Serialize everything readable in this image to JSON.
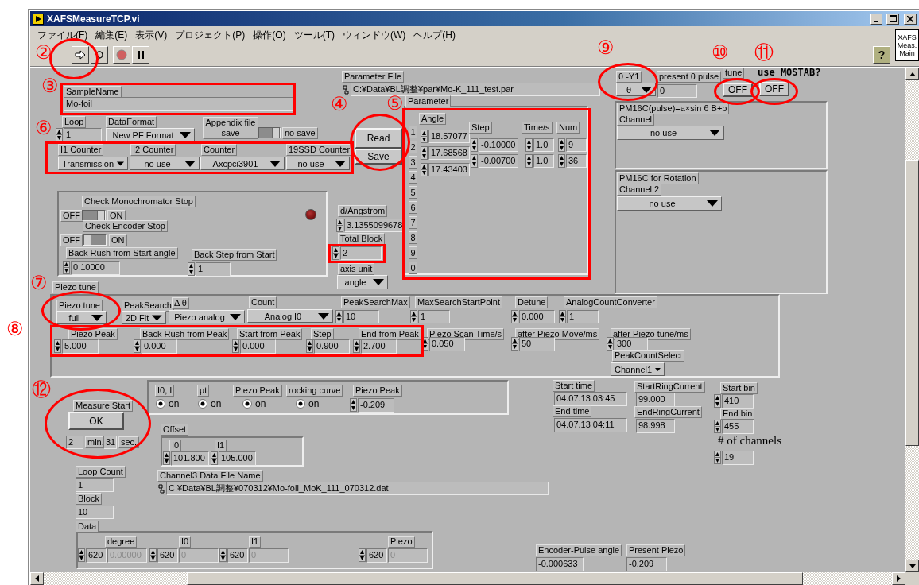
{
  "window": {
    "title": "XAFSMeasureTCP.vi"
  },
  "menu": [
    "ファイル(F)",
    "編集(E)",
    "表示(V)",
    "プロジェクト(P)",
    "操作(O)",
    "ツール(T)",
    "ウィンドウ(W)",
    "ヘルプ(H)"
  ],
  "toolbar": [
    {
      "kind": "run"
    },
    {
      "kind": "run-continuous"
    },
    {
      "kind": "abort"
    },
    {
      "kind": "pause"
    },
    {
      "kind": "help",
      "text": "?"
    }
  ],
  "icon_pane": [
    "XAFS",
    "Meas.",
    "Main"
  ],
  "panel": {
    "items": [
      {
        "kind": "cluster"
      },
      {
        "kind": "cluster"
      },
      {
        "kind": "cluster"
      },
      {
        "kind": "cluster"
      },
      {
        "kind": "cluster"
      },
      {
        "kind": "cluster"
      },
      {
        "kind": "cluster"
      },
      {
        "kind": "cluster"
      },
      {
        "kind": "label",
        "text": "SampleName"
      },
      {
        "kind": "string",
        "value": "Mo-foil"
      },
      {
        "kind": "label",
        "text": "Parameter File"
      },
      {
        "kind": "path",
        "value": "C:¥Data¥BL調整¥par¥Mo-K_111_test.par"
      },
      {
        "kind": "label",
        "text": "Loop"
      },
      {
        "kind": "numeric",
        "value": "1"
      },
      {
        "kind": "label",
        "text": "DataFormat"
      },
      {
        "kind": "ring",
        "value": "New PF Format"
      },
      {
        "kind": "label",
        "text": "Appendix file save"
      },
      {
        "kind": "toggle",
        "on": true
      },
      {
        "kind": "label",
        "text": "no save"
      },
      {
        "kind": "label",
        "text": "I1 Counter"
      },
      {
        "kind": "ring",
        "value": "Transmission"
      },
      {
        "kind": "label",
        "text": "I2 Counter"
      },
      {
        "kind": "ring",
        "value": "no use"
      },
      {
        "kind": "label",
        "text": "Counter"
      },
      {
        "kind": "ring",
        "value": "Axcpci3901"
      },
      {
        "kind": "label",
        "text": "19SSD Counter"
      },
      {
        "kind": "ring",
        "value": "no use"
      },
      {
        "kind": "button",
        "text": "Read"
      },
      {
        "kind": "button",
        "text": "Save"
      },
      {
        "kind": "label",
        "text": "Parameter"
      },
      {
        "kind": "label",
        "text": "Angle"
      },
      {
        "kind": "array-index",
        "values": [
          "1",
          "2",
          "3",
          "4",
          "5",
          "6",
          "7",
          "8",
          "9",
          "0"
        ]
      },
      {
        "kind": "numeric",
        "value": "18.57077"
      },
      {
        "kind": "numeric",
        "value": "17.68568"
      },
      {
        "kind": "numeric",
        "value": "17.43403"
      },
      {
        "kind": "label",
        "text": "Step"
      },
      {
        "kind": "numeric",
        "value": "-0.10000"
      },
      {
        "kind": "numeric",
        "value": "-0.00700"
      },
      {
        "kind": "label",
        "text": "Time/s"
      },
      {
        "kind": "numeric",
        "value": "1.0"
      },
      {
        "kind": "numeric",
        "value": "1.0"
      },
      {
        "kind": "label",
        "text": "Num"
      },
      {
        "kind": "numeric",
        "value": "9"
      },
      {
        "kind": "numeric",
        "value": "36"
      },
      {
        "kind": "label",
        "text": "θ -Y1"
      },
      {
        "kind": "ring",
        "value": "θ"
      },
      {
        "kind": "label",
        "text": "present θ pulse"
      },
      {
        "kind": "indicator",
        "value": "0",
        "disabled": false
      },
      {
        "kind": "label",
        "text": "tune"
      },
      {
        "kind": "button",
        "text": "OFF"
      },
      {
        "kind": "heading",
        "text": "use MOSTAB?"
      },
      {
        "kind": "button",
        "text": "OFF"
      },
      {
        "kind": "label",
        "text": "PM16C(pulse)=a×sin θ B+b"
      },
      {
        "kind": "label",
        "text": "Channel"
      },
      {
        "kind": "ring",
        "value": "no use"
      },
      {
        "kind": "label",
        "text": "PM16C for Rotation"
      },
      {
        "kind": "label",
        "text": "Channel 2"
      },
      {
        "kind": "ring",
        "value": "no use"
      },
      {
        "kind": "label",
        "text": "Check Monochromator Stop"
      },
      {
        "kind": "label",
        "text": "OFF"
      },
      {
        "kind": "toggle",
        "on": true
      },
      {
        "kind": "label",
        "text": "ON"
      },
      {
        "kind": "label",
        "text": "Check Encoder Stop"
      },
      {
        "kind": "label",
        "text": "OFF"
      },
      {
        "kind": "toggle",
        "on": false
      },
      {
        "kind": "label",
        "text": "ON"
      },
      {
        "kind": "label",
        "text": "Back Rush from Start angle"
      },
      {
        "kind": "numeric",
        "value": "0.10000"
      },
      {
        "kind": "label",
        "text": "Back Step from Start"
      },
      {
        "kind": "numeric",
        "value": "1"
      },
      {
        "kind": "led",
        "on": false
      },
      {
        "kind": "label",
        "text": "d/Angstrom"
      },
      {
        "kind": "numeric",
        "value": "3.1355099678"
      },
      {
        "kind": "label",
        "text": "Total Block"
      },
      {
        "kind": "numeric",
        "value": "2"
      },
      {
        "kind": "label",
        "text": "axis unit"
      },
      {
        "kind": "ring",
        "value": "angle"
      },
      {
        "kind": "label",
        "text": "Piezo tune"
      },
      {
        "kind": "label",
        "text": "Piezo tune"
      },
      {
        "kind": "ring",
        "value": "full"
      },
      {
        "kind": "label",
        "text": "PeakSearch"
      },
      {
        "kind": "ring",
        "value": "2D Fit"
      },
      {
        "kind": "label",
        "text": "Δ θ"
      },
      {
        "kind": "ring",
        "value": "Piezo analog"
      },
      {
        "kind": "label",
        "text": "Count"
      },
      {
        "kind": "ring",
        "value": "Analog I0"
      },
      {
        "kind": "label",
        "text": "PeakSearchMax"
      },
      {
        "kind": "numeric",
        "value": "10"
      },
      {
        "kind": "label",
        "text": "MaxSearchStartPoint"
      },
      {
        "kind": "numeric",
        "value": "1"
      },
      {
        "kind": "label",
        "text": "Detune"
      },
      {
        "kind": "numeric",
        "value": "0.000"
      },
      {
        "kind": "label",
        "text": "AnalogCountConverter"
      },
      {
        "kind": "numeric",
        "value": "1"
      },
      {
        "kind": "label",
        "text": "Piezo Peak"
      },
      {
        "kind": "numeric",
        "value": "5.000"
      },
      {
        "kind": "label",
        "text": "Back Rush from Peak"
      },
      {
        "kind": "numeric",
        "value": "0.000"
      },
      {
        "kind": "label",
        "text": "Start from Peak"
      },
      {
        "kind": "numeric",
        "value": "0.000"
      },
      {
        "kind": "label",
        "text": "Step"
      },
      {
        "kind": "numeric",
        "value": "0.900"
      },
      {
        "kind": "label",
        "text": "End from Peak"
      },
      {
        "kind": "numeric",
        "value": "2.700"
      },
      {
        "kind": "label",
        "text": "Piezo Scan Time/s"
      },
      {
        "kind": "numeric",
        "value": "0.050"
      },
      {
        "kind": "label",
        "text": "after Piezo Move/ms"
      },
      {
        "kind": "numeric",
        "value": "50"
      },
      {
        "kind": "label",
        "text": "after Piezo tune/ms"
      },
      {
        "kind": "numeric",
        "value": "300"
      },
      {
        "kind": "label",
        "text": "PeakCountSelect"
      },
      {
        "kind": "ring",
        "value": "Channel1"
      },
      {
        "kind": "label",
        "text": "Measure Start"
      },
      {
        "kind": "button",
        "text": "OK"
      },
      {
        "kind": "indicator",
        "value": "2",
        "disabled": false
      },
      {
        "kind": "label",
        "text": "min."
      },
      {
        "kind": "indicator",
        "value": "31",
        "disabled": false
      },
      {
        "kind": "label",
        "text": "sec."
      },
      {
        "kind": "label",
        "text": "I0, I"
      },
      {
        "kind": "radio",
        "text": "on",
        "selected": true
      },
      {
        "kind": "label",
        "text": "μt"
      },
      {
        "kind": "radio",
        "text": "on",
        "selected": true
      },
      {
        "kind": "label",
        "text": "Piezo Peak"
      },
      {
        "kind": "radio",
        "text": "on",
        "selected": true
      },
      {
        "kind": "label",
        "text": "rocking curve"
      },
      {
        "kind": "radio",
        "text": "on",
        "selected": true
      },
      {
        "kind": "label",
        "text": "Piezo Peak"
      },
      {
        "kind": "numeric",
        "value": "-0.209"
      },
      {
        "kind": "label",
        "text": "Offset"
      },
      {
        "kind": "label",
        "text": "I0"
      },
      {
        "kind": "label",
        "text": "I1"
      },
      {
        "kind": "numeric",
        "value": "101.800"
      },
      {
        "kind": "numeric",
        "value": "105.000"
      },
      {
        "kind": "label",
        "text": "Loop Count"
      },
      {
        "kind": "indicator",
        "value": "1",
        "disabled": false
      },
      {
        "kind": "label",
        "text": "Channel3 Data File Name"
      },
      {
        "kind": "path",
        "value": "C:¥Data¥BL調整¥070312¥Mo-foil_MoK_111_070312.dat"
      },
      {
        "kind": "label",
        "text": "Block"
      },
      {
        "kind": "indicator",
        "value": "10",
        "disabled": false
      },
      {
        "kind": "label",
        "text": "Data"
      },
      {
        "kind": "label",
        "text": "degree"
      },
      {
        "kind": "numeric",
        "value": "620"
      },
      {
        "kind": "indicator",
        "value": "0.00000",
        "disabled": true
      },
      {
        "kind": "label",
        "text": "I0"
      },
      {
        "kind": "numeric",
        "value": "620"
      },
      {
        "kind": "indicator",
        "value": "0",
        "disabled": true
      },
      {
        "kind": "label",
        "text": "I1"
      },
      {
        "kind": "numeric",
        "value": "620"
      },
      {
        "kind": "indicator",
        "value": "0",
        "disabled": true
      },
      {
        "kind": "label",
        "text": "Piezo"
      },
      {
        "kind": "numeric",
        "value": "620"
      },
      {
        "kind": "indicator",
        "value": "0",
        "disabled": true
      },
      {
        "kind": "label",
        "text": "Start time"
      },
      {
        "kind": "indicator",
        "value": "04.07.13 03:45",
        "disabled": false
      },
      {
        "kind": "label",
        "text": "End time"
      },
      {
        "kind": "indicator",
        "value": "04.07.13 04:11",
        "disabled": false
      },
      {
        "kind": "label",
        "text": "StartRingCurrent"
      },
      {
        "kind": "indicator",
        "value": "99.000",
        "disabled": false
      },
      {
        "kind": "label",
        "text": "EndRingCurrent"
      },
      {
        "kind": "indicator",
        "value": "98.998",
        "disabled": false
      },
      {
        "kind": "label",
        "text": "Start bin"
      },
      {
        "kind": "numeric",
        "value": "410"
      },
      {
        "kind": "label",
        "text": "End bin"
      },
      {
        "kind": "numeric",
        "value": "455"
      },
      {
        "kind": "caption",
        "text": "# of channels"
      },
      {
        "kind": "numeric",
        "value": "19"
      },
      {
        "kind": "label",
        "text": "Encoder-Pulse angle"
      },
      {
        "kind": "indicator",
        "value": "-0.000633",
        "disabled": false
      },
      {
        "kind": "label",
        "text": "Present Piezo"
      },
      {
        "kind": "indicator",
        "value": "-0.209",
        "disabled": false
      }
    ]
  },
  "annotations": [
    {
      "kind": "number",
      "text": "②"
    },
    {
      "kind": "ellipse"
    },
    {
      "kind": "number",
      "text": "③"
    },
    {
      "kind": "rect"
    },
    {
      "kind": "number",
      "text": "④"
    },
    {
      "kind": "number",
      "text": "⑤"
    },
    {
      "kind": "ellipse"
    },
    {
      "kind": "number",
      "text": "⑥"
    },
    {
      "kind": "rect"
    },
    {
      "kind": "rect"
    },
    {
      "kind": "number",
      "text": "⑦"
    },
    {
      "kind": "number",
      "text": "⑧"
    },
    {
      "kind": "ellipse"
    },
    {
      "kind": "rect"
    },
    {
      "kind": "number",
      "text": "⑨"
    },
    {
      "kind": "ellipse"
    },
    {
      "kind": "number",
      "text": "⑩"
    },
    {
      "kind": "ellipse"
    },
    {
      "kind": "number",
      "text": "⑪"
    },
    {
      "kind": "ellipse"
    },
    {
      "kind": "rect"
    },
    {
      "kind": "number",
      "text": "⑫"
    },
    {
      "kind": "ellipse"
    }
  ]
}
